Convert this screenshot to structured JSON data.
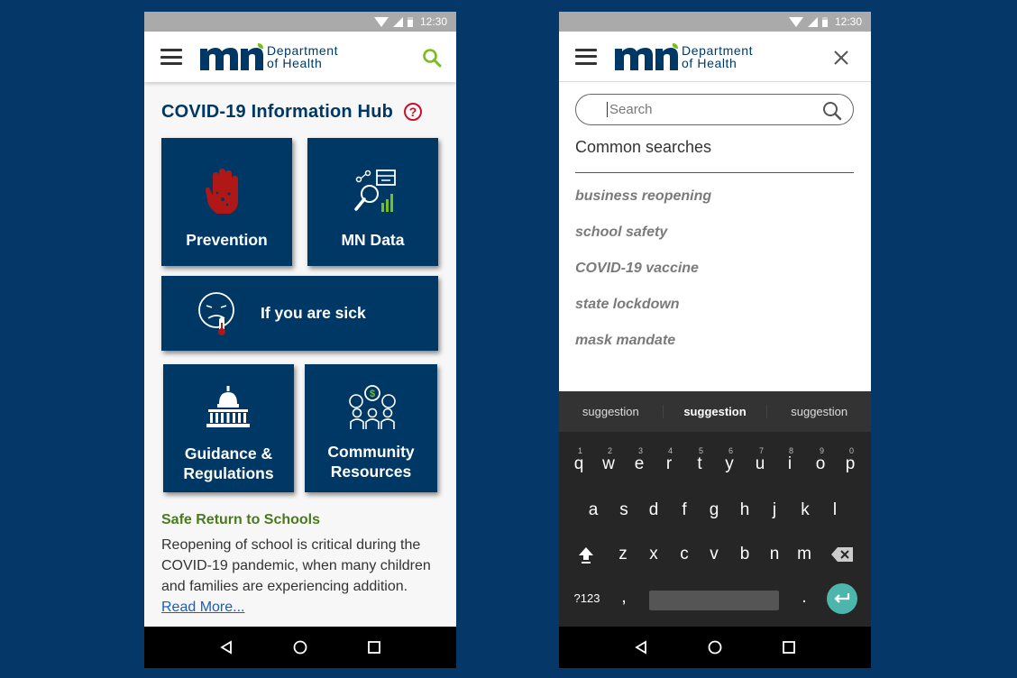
{
  "status": {
    "time": "12:30"
  },
  "brand": {
    "line1": "Department",
    "line2": "of Health"
  },
  "left": {
    "title": "COVID-19 Information Hub",
    "help": "?",
    "tiles": {
      "prevention": "Prevention",
      "mn_data": "MN Data",
      "sick": "If you are sick",
      "guidance_1": "Guidance &",
      "guidance_2": "Regulations",
      "community_1": "Community",
      "community_2": "Resources"
    },
    "article": {
      "title": "Safe Return to Schools",
      "body": "Reopening of school is critical during the COVID-19 pandemic, when many children and families are experiencing addition. ",
      "read_more": "Read More..."
    }
  },
  "right": {
    "search_placeholder": "Search",
    "common_title": "Common searches",
    "suggestions": [
      "business reopening",
      "school safety",
      "COVID-19 vaccine",
      "state lockdown",
      "mask mandate"
    ],
    "keyboard": {
      "suggestions": [
        "suggestion",
        "suggestion",
        "suggestion"
      ],
      "row1": [
        "q",
        "w",
        "e",
        "r",
        "t",
        "y",
        "u",
        "i",
        "o",
        "p"
      ],
      "row1_digits": [
        "1",
        "2",
        "3",
        "4",
        "5",
        "6",
        "7",
        "8",
        "9",
        "0"
      ],
      "row2": [
        "a",
        "s",
        "d",
        "f",
        "g",
        "h",
        "j",
        "k",
        "l"
      ],
      "row3": [
        "z",
        "x",
        "c",
        "v",
        "b",
        "n",
        "m"
      ],
      "symbols": "?123",
      "comma": ",",
      "period": "."
    }
  },
  "colors": {
    "background": "#053868",
    "brand_navy": "#003865",
    "brand_green": "#78be20",
    "alert_red": "#c8102e",
    "article_green": "#4a7a1e",
    "enter_teal": "#4db6ac"
  }
}
